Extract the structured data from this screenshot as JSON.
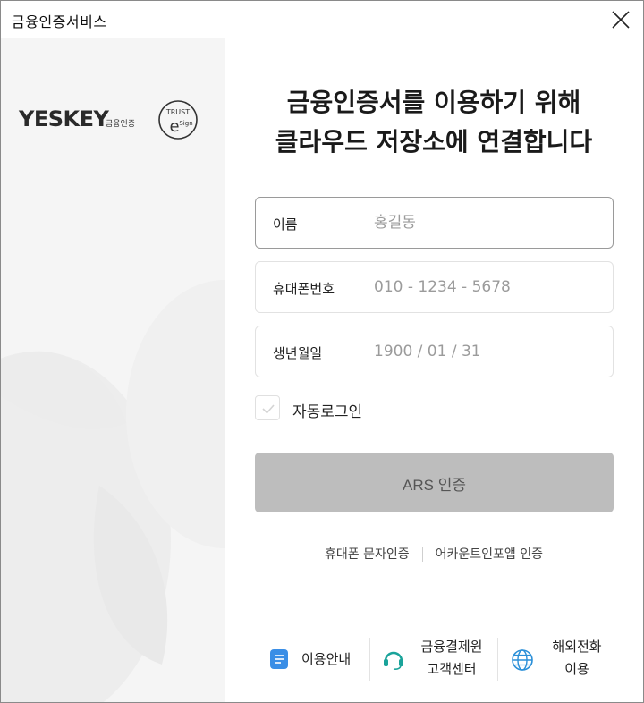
{
  "window": {
    "title": "금융인증서비스",
    "close_icon": "close-icon"
  },
  "brand": {
    "wordmark": "YESKEY",
    "sub_label": "금융인증",
    "seal_text_top": "TRUST",
    "seal_text_inner": "Sign",
    "seal_letter": "e"
  },
  "headline": {
    "line1": "금융인증서를 이용하기 위해",
    "line2": "클라우드 저장소에 연결합니다"
  },
  "form": {
    "name": {
      "label": "이름",
      "placeholder": "홍길동"
    },
    "phone": {
      "label": "휴대폰번호",
      "placeholder": "010 - 1234 - 5678"
    },
    "birth": {
      "label": "생년월일",
      "placeholder": "1900 / 01 / 31"
    },
    "auto_login": {
      "label": "자동로그인",
      "checked": false
    }
  },
  "ars_button": {
    "label": "ARS 인증",
    "enabled": false
  },
  "alt_methods": {
    "sms": "휴대폰 문자인증",
    "account_info": "어카운트인포앱 인증"
  },
  "footer": {
    "guide": {
      "label": "이용안내",
      "icon": "document-icon"
    },
    "support": {
      "line1": "금융결제원",
      "line2": "고객센터",
      "icon": "headset-icon"
    },
    "overseas": {
      "line1": "해외전화",
      "line2": "이용",
      "icon": "globe-icon"
    }
  },
  "colors": {
    "left_panel_bg": "#f5f5f5",
    "button_disabled": "#bdbdbd",
    "guide_icon": "#3a8ee6",
    "support_icon": "#1aa39a",
    "globe_icon": "#2a8fd8"
  }
}
